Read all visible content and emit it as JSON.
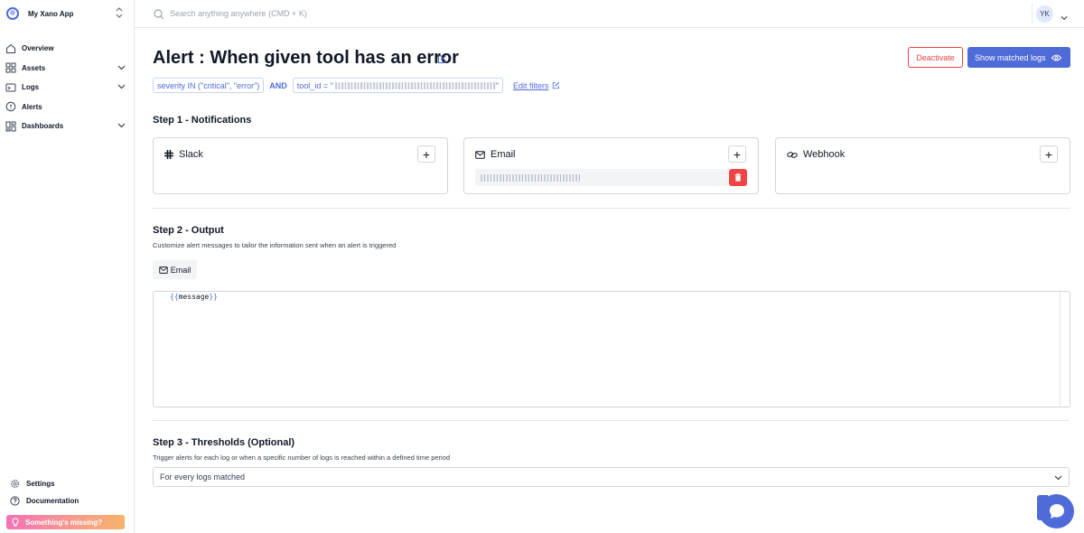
{
  "sidebar": {
    "app_name": "My Xano App",
    "items": [
      {
        "label": "Overview",
        "icon": "home-icon"
      },
      {
        "label": "Assets",
        "icon": "grid-icon"
      },
      {
        "label": "Logs",
        "icon": "logs-icon"
      },
      {
        "label": "Alerts",
        "icon": "alert-icon"
      },
      {
        "label": "Dashboards",
        "icon": "dashboard-icon"
      }
    ],
    "bottom_items": [
      {
        "label": "Settings",
        "icon": "gear-icon"
      },
      {
        "label": "Documentation",
        "icon": "help-icon"
      }
    ],
    "missing_label": "Something's missing?"
  },
  "topbar": {
    "search_placeholder": "Search anything anywhere (CMD + K)",
    "user_initials": "YK"
  },
  "header": {
    "title": "Alert : When given tool has an error",
    "deactivate_label": "Deactivate",
    "show_logs_label": "Show matched logs"
  },
  "filters": {
    "severity": "severity IN (\"critical\", \"error\")",
    "join": "AND",
    "tool_id_prefix": "tool_id = \"",
    "tool_id_suffix": "\"",
    "edit_label": "Edit filters"
  },
  "step1": {
    "title": "Step 1 - Notifications",
    "cards": [
      {
        "label": "Slack",
        "icon": "slack-icon"
      },
      {
        "label": "Email",
        "icon": "mail-icon"
      },
      {
        "label": "Webhook",
        "icon": "link-icon"
      }
    ]
  },
  "step2": {
    "title": "Step 2 - Output",
    "desc": "Customize alert messages to tailor the information sent when an alert is triggered",
    "tab_label": "Email",
    "editor": {
      "open": "{{",
      "var": "message",
      "close": "}}"
    }
  },
  "step3": {
    "title": "Step 3 - Thresholds (Optional)",
    "desc": "Trigger alerts for each log or when a specific number of logs is reached within a defined time period",
    "selected": "For every logs matched"
  },
  "colors": {
    "accent": "#4f6bd8",
    "danger": "#ef4444"
  }
}
